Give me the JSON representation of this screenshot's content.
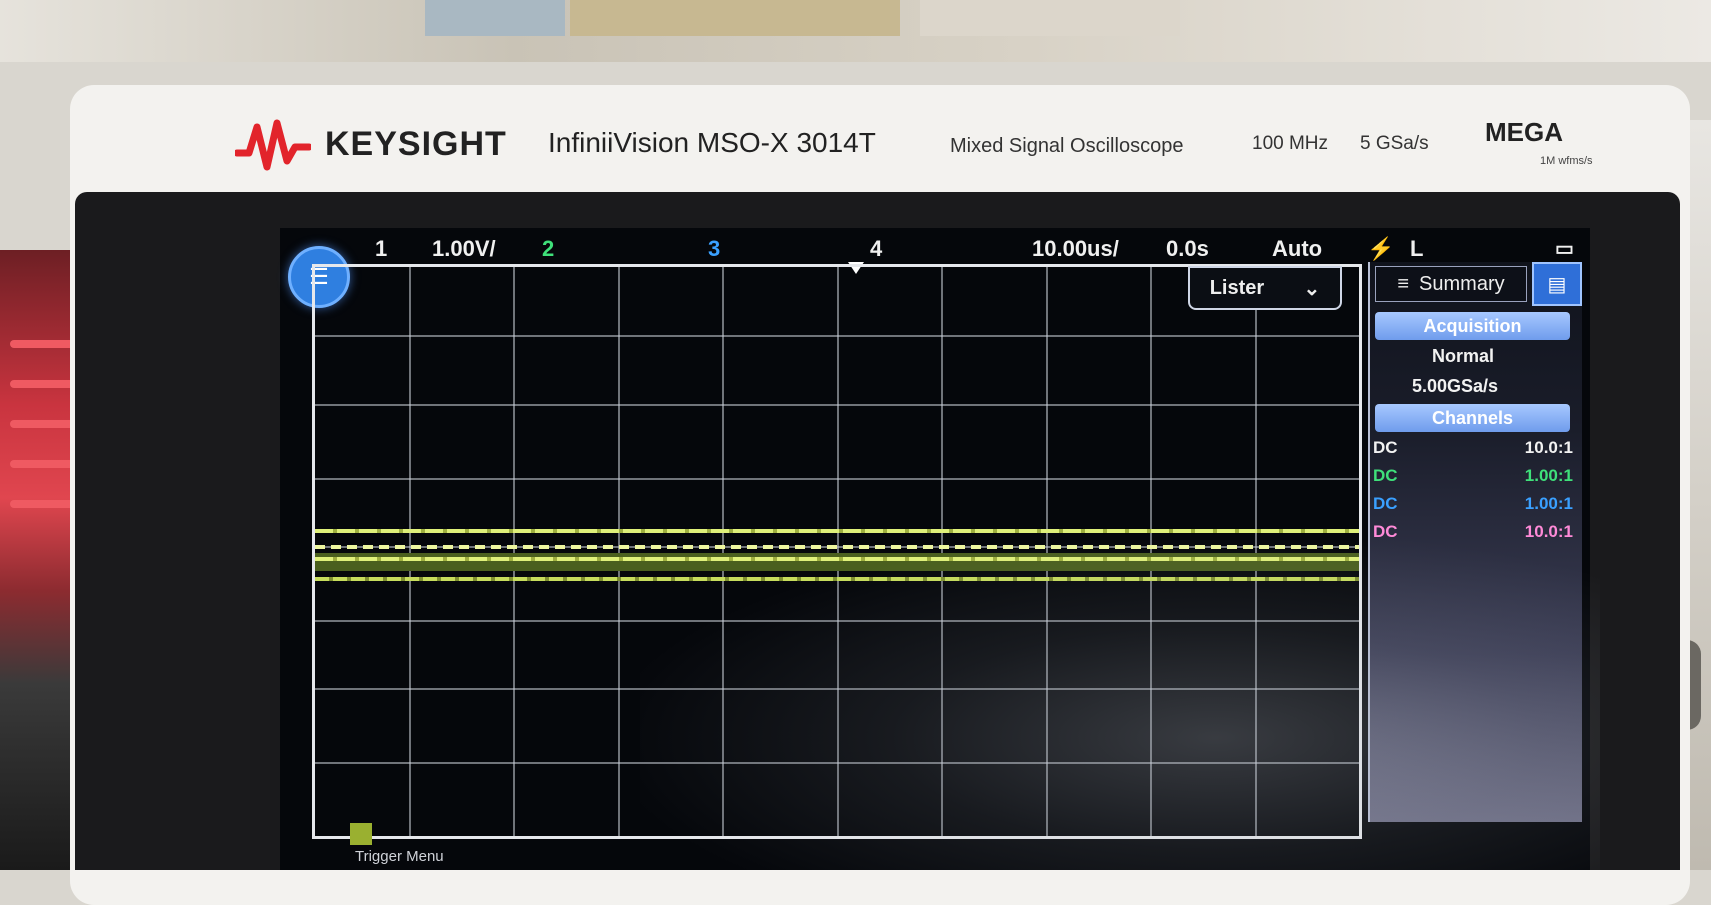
{
  "brand": {
    "name": "KEYSIGHT",
    "model": "InfiniiVision MSO-X 3014T",
    "model_sub": "Mixed Signal Oscilloscope",
    "bandwidth": "100 MHz",
    "sample_rate_spec": "5 GSa/s",
    "megazoom": "MEGA",
    "megazoom_sub": "1M wfms/s"
  },
  "status_bar": {
    "ch1": "1",
    "ch1_scale": "1.00V/",
    "ch2": "2",
    "ch3": "3",
    "ch4": "4",
    "timebase": "10.00us/",
    "delay": "0.0s",
    "trigger_mode": "Auto",
    "trigger_source": "L"
  },
  "lister_button": {
    "label": "Lister"
  },
  "trigger_menu": {
    "label": "Trigger Menu"
  },
  "side_panel": {
    "header": "Summary",
    "acquisition_header": "Acquisition",
    "acquisition_mode": "Normal",
    "acquisition_rate": "5.00GSa/s",
    "channels_header": "Channels",
    "channels": [
      {
        "coupling": "DC",
        "ratio": "10.0:1",
        "color": "#f2f2f2"
      },
      {
        "coupling": "DC",
        "ratio": "1.00:1",
        "color": "#3fe07a"
      },
      {
        "coupling": "DC",
        "ratio": "1.00:1",
        "color": "#3aa0ff"
      },
      {
        "coupling": "DC",
        "ratio": "10.0:1",
        "color": "#ff8ad8"
      }
    ]
  },
  "colors": {
    "ch1": "#f2f2f2",
    "ch2": "#3fe07a",
    "ch3": "#3aa0ff",
    "ch4": "#f2f2f2",
    "trace": "#dff07a",
    "keysight_red": "#e2242b"
  }
}
